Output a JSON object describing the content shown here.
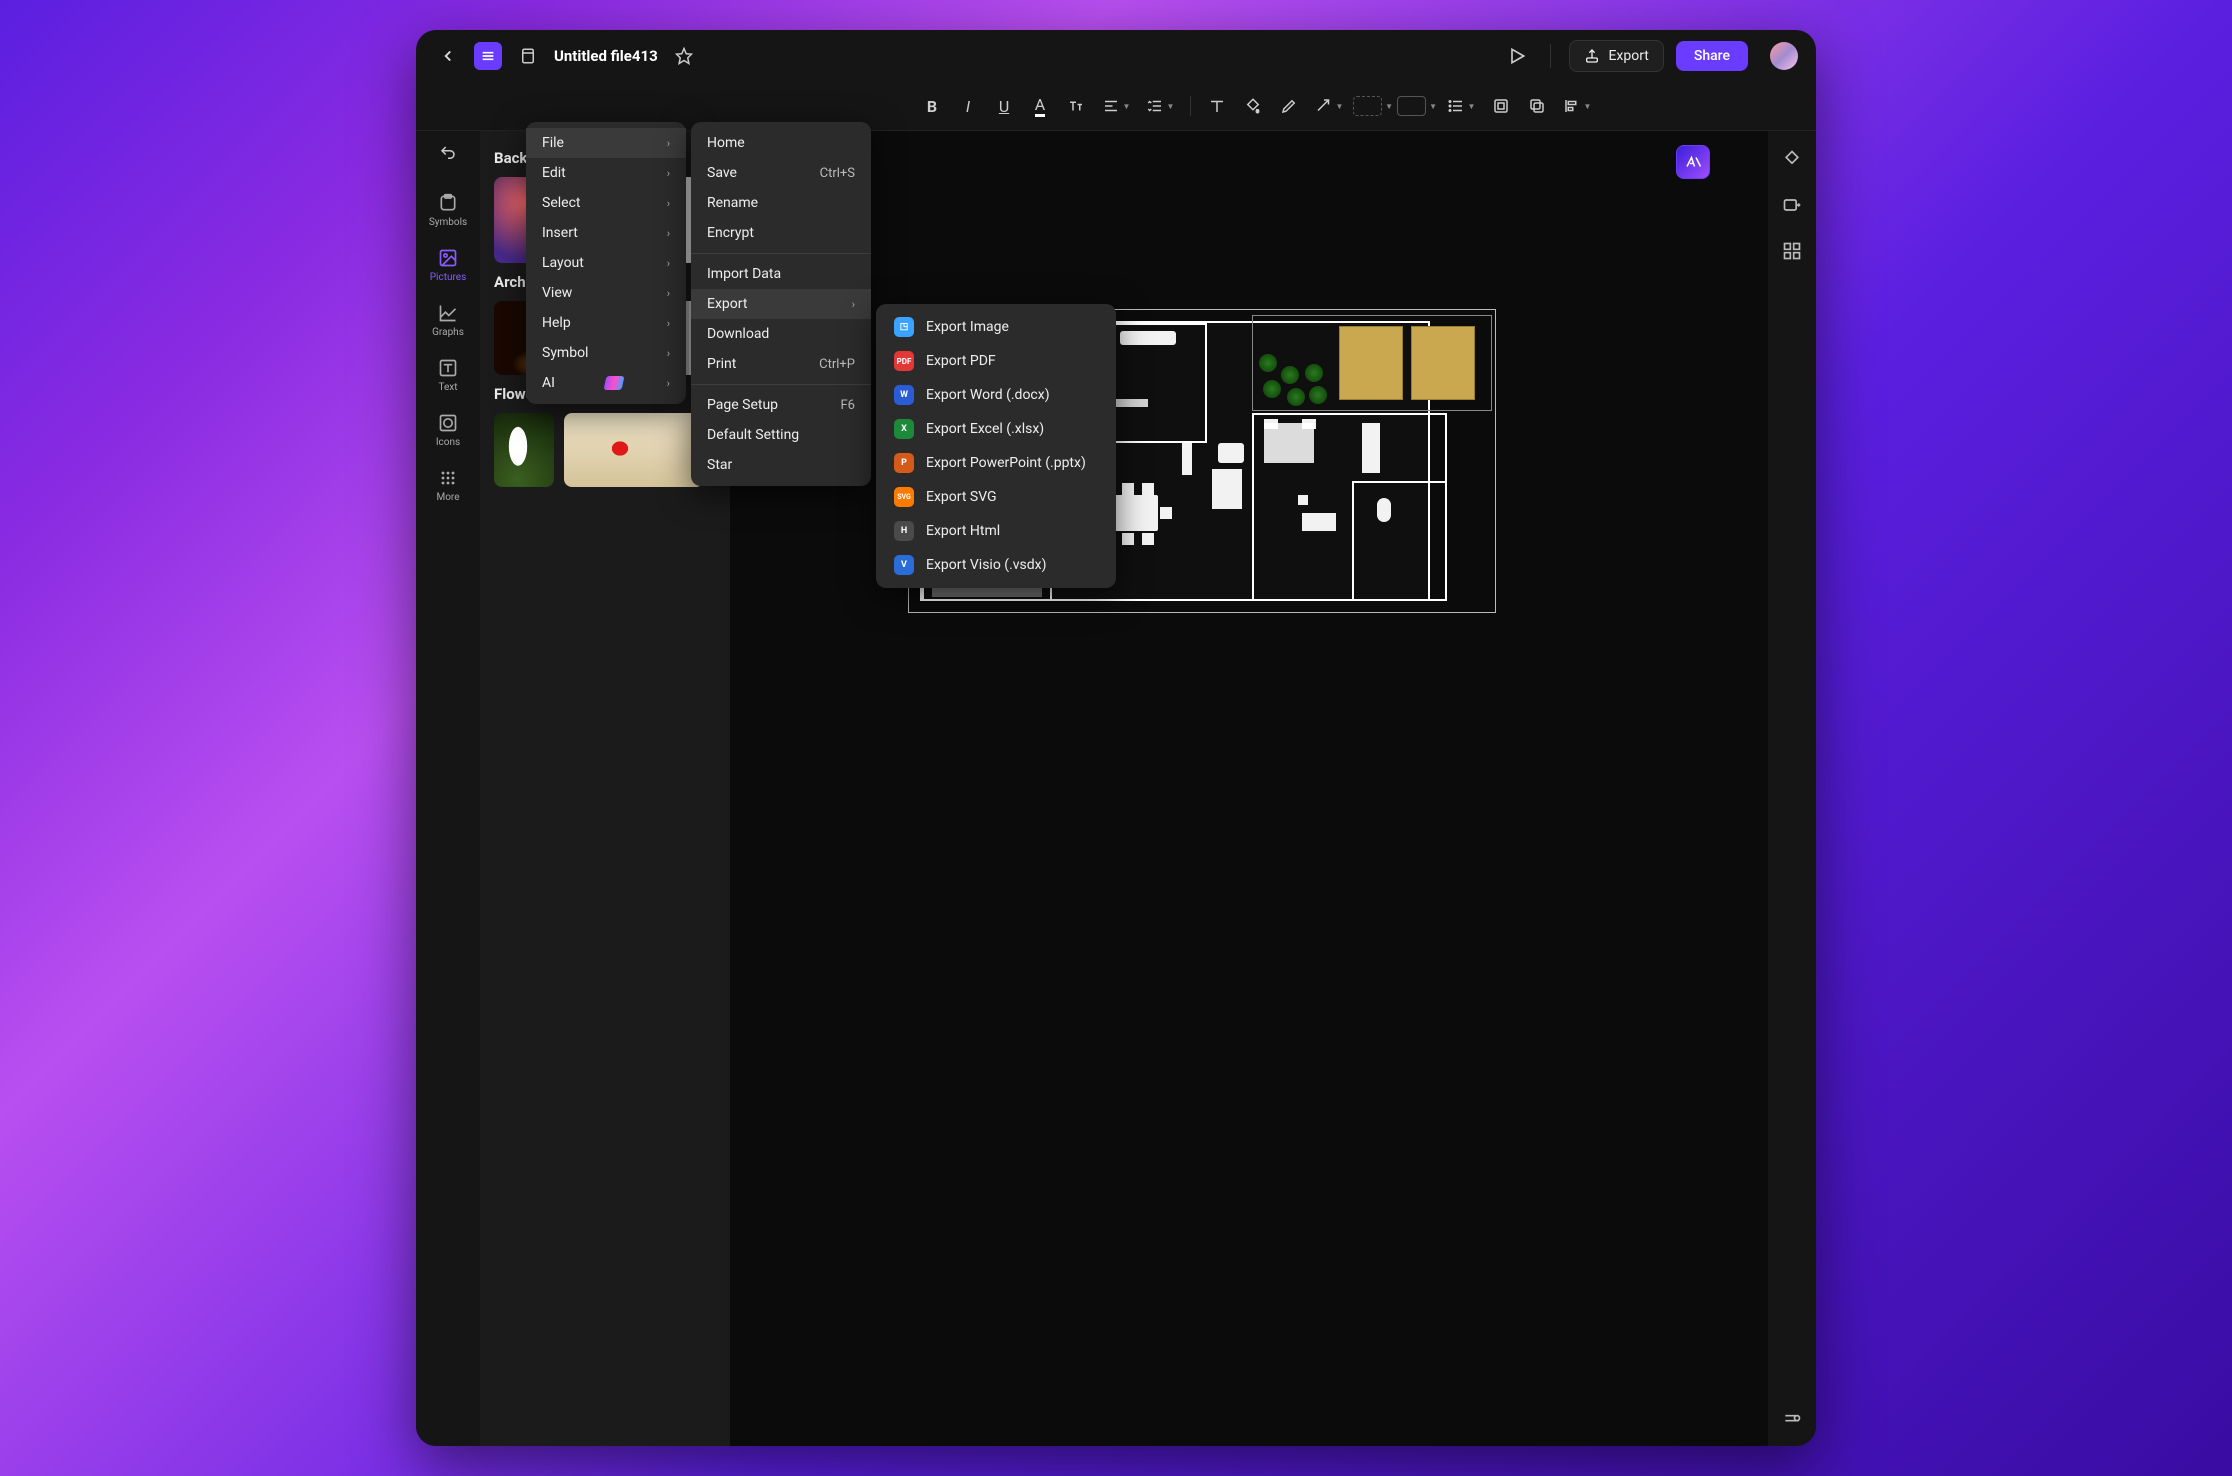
{
  "header": {
    "title": "Untitled file413",
    "export_label": "Export",
    "share_label": "Share"
  },
  "left_rail": {
    "items": [
      {
        "label": "Symbols"
      },
      {
        "label": "Pictures"
      },
      {
        "label": "Graphs"
      },
      {
        "label": "Text"
      },
      {
        "label": "Icons"
      },
      {
        "label": "More"
      }
    ]
  },
  "panel": {
    "sections": [
      {
        "title": "Background"
      },
      {
        "title": "Architecture"
      },
      {
        "title": "Flower"
      }
    ]
  },
  "main_menu": {
    "items": [
      {
        "label": "File",
        "sub": true,
        "active": true
      },
      {
        "label": "Edit",
        "sub": true
      },
      {
        "label": "Select",
        "sub": true
      },
      {
        "label": "Insert",
        "sub": true
      },
      {
        "label": "Layout",
        "sub": true
      },
      {
        "label": "View",
        "sub": true
      },
      {
        "label": "Help",
        "sub": true
      },
      {
        "label": "Symbol",
        "sub": true
      },
      {
        "label": "AI",
        "sub": true,
        "ai": true
      }
    ]
  },
  "file_menu": {
    "items_a": [
      {
        "label": "Home"
      },
      {
        "label": "Save",
        "shortcut": "Ctrl+S"
      },
      {
        "label": "Rename"
      },
      {
        "label": "Encrypt"
      }
    ],
    "items_b": [
      {
        "label": "Import Data"
      },
      {
        "label": "Export",
        "sub": true,
        "active": true
      },
      {
        "label": "Download"
      },
      {
        "label": "Print",
        "shortcut": "Ctrl+P"
      }
    ],
    "items_c": [
      {
        "label": "Page Setup",
        "shortcut": "F6"
      },
      {
        "label": "Default Setting"
      },
      {
        "label": "Star"
      }
    ]
  },
  "export_menu": {
    "items": [
      {
        "icon": "img",
        "icon_label": "◳",
        "label": "Export Image"
      },
      {
        "icon": "pdf",
        "icon_label": "PDF",
        "label": "Export PDF"
      },
      {
        "icon": "word",
        "icon_label": "W",
        "label": "Export Word (.docx)"
      },
      {
        "icon": "xls",
        "icon_label": "X",
        "label": "Export Excel (.xlsx)"
      },
      {
        "icon": "ppt",
        "icon_label": "P",
        "label": "Export PowerPoint (.pptx)"
      },
      {
        "icon": "svg",
        "icon_label": "SVG",
        "label": "Export SVG"
      },
      {
        "icon": "html",
        "icon_label": "H",
        "label": "Export Html"
      },
      {
        "icon": "visio",
        "icon_label": "V",
        "label": "Export Visio (.vsdx)"
      }
    ]
  }
}
